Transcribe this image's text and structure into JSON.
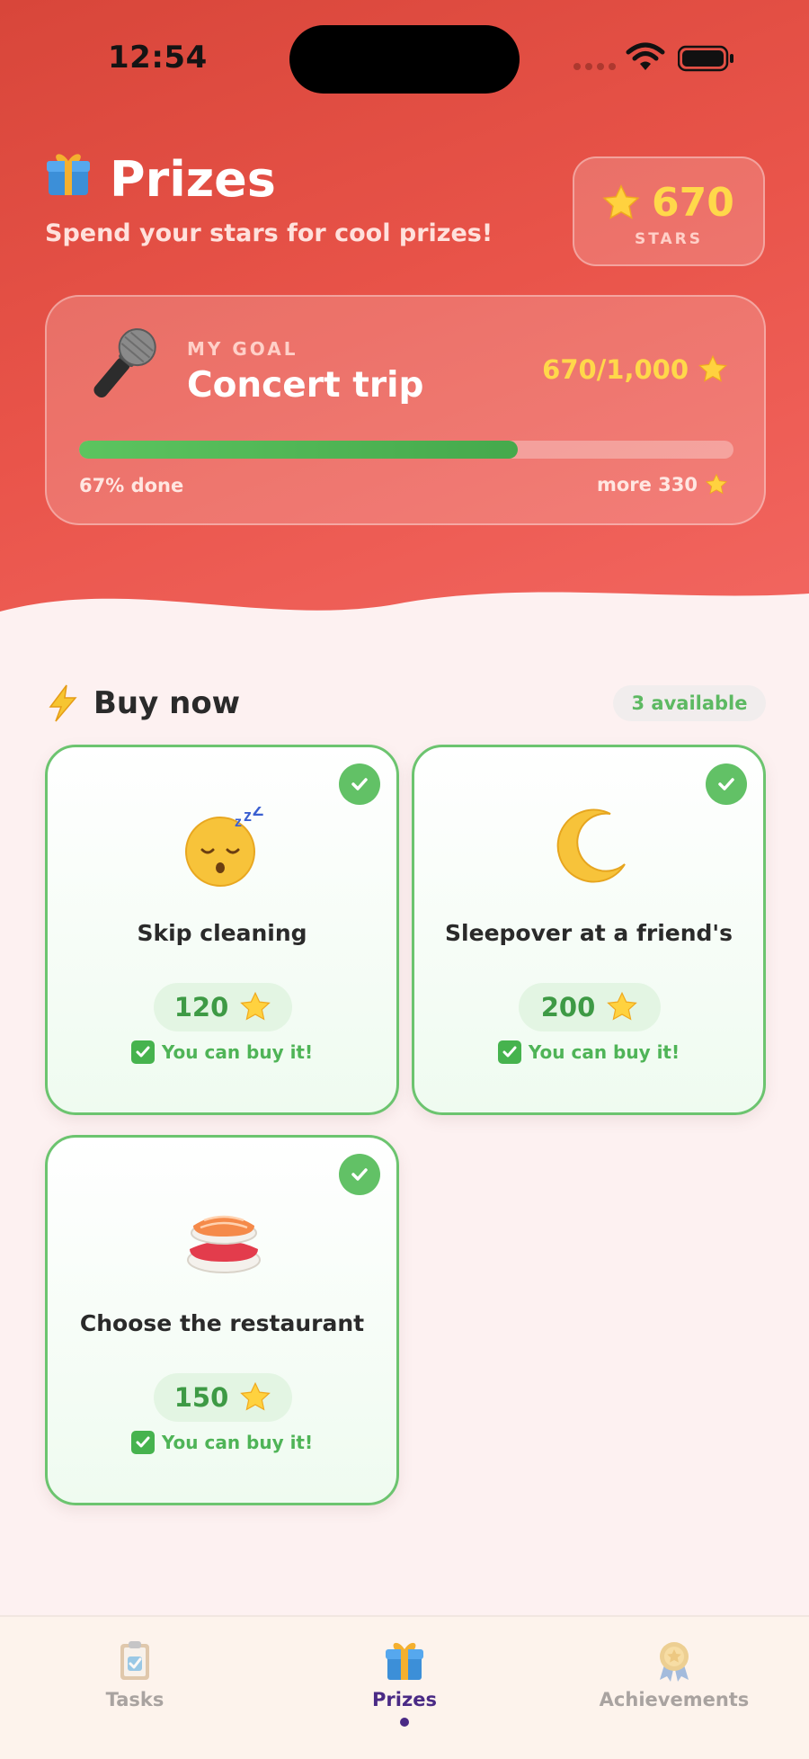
{
  "status_bar": {
    "time": "12:54"
  },
  "header": {
    "title": "Prizes",
    "subtitle": "Spend your stars for cool prizes!",
    "stars_value": "670",
    "stars_label": "STARS"
  },
  "goal": {
    "label": "MY GOAL",
    "title": "Concert trip",
    "progress_text": "670/1,000",
    "progress_fraction": 0.67,
    "done_text": "67% done",
    "more_text": "more 330"
  },
  "section": {
    "title": "Buy now",
    "badge": "3 available"
  },
  "prizes": [
    {
      "title": "Skip cleaning",
      "price": "120",
      "status": "You can buy it!"
    },
    {
      "title": "Sleepover at a friend's",
      "price": "200",
      "status": "You can buy it!"
    },
    {
      "title": "Choose the restaurant",
      "price": "150",
      "status": "You can buy it!"
    }
  ],
  "nav": {
    "tasks": "Tasks",
    "prizes": "Prizes",
    "achievements": "Achievements",
    "active": "prizes"
  },
  "colors": {
    "hero": "#e14d42",
    "accent_green": "#62c166",
    "star_yellow": "#ffd84a",
    "nav_active": "#4a2a85"
  }
}
